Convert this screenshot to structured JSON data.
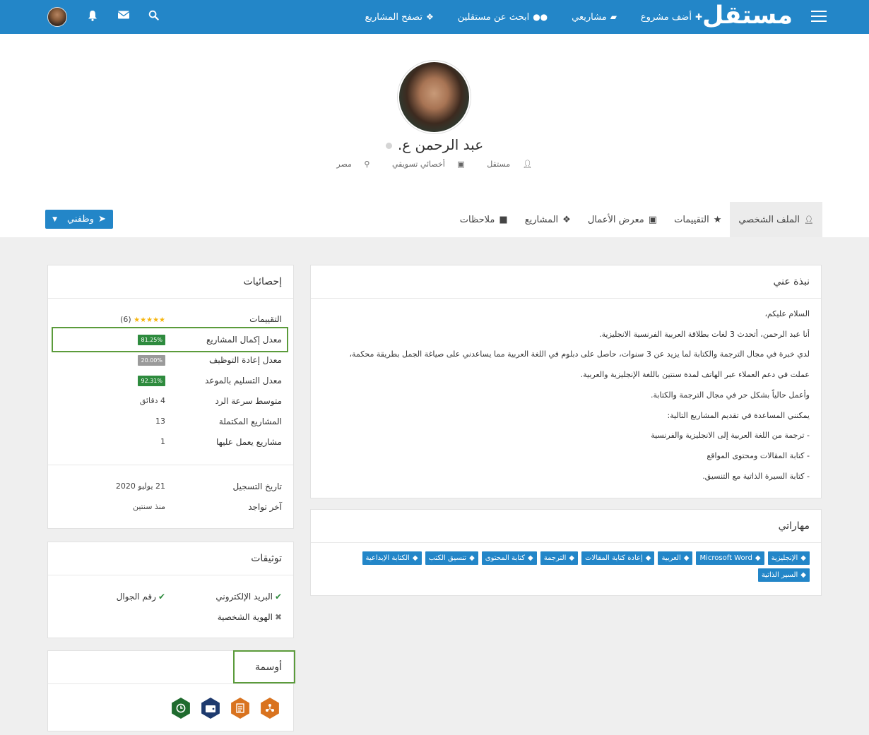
{
  "nav": {
    "logo": "مستقل",
    "links": [
      {
        "label": "أضف مشروع",
        "icon": "plus-icon"
      },
      {
        "label": "مشاريعي",
        "icon": "folder-icon"
      },
      {
        "label": "ابحث عن مستقلين",
        "icon": "users-icon"
      },
      {
        "label": "تصفح المشاريع",
        "icon": "cubes-icon"
      }
    ]
  },
  "profile": {
    "name": "عبد الرحمن ع.",
    "role_site": "مستقل",
    "title": "أخصائي تسويقي",
    "country": "مصر"
  },
  "tabs": [
    {
      "label": "الملف الشخصي",
      "icon": "user-icon"
    },
    {
      "label": "التقييمات",
      "icon": "star-icon"
    },
    {
      "label": "معرض الأعمال",
      "icon": "briefcase-icon"
    },
    {
      "label": "المشاريع",
      "icon": "cubes-icon"
    },
    {
      "label": "ملاحظات",
      "icon": "note-icon"
    }
  ],
  "hire_button": "وظفني",
  "about": {
    "title": "نبذة عني",
    "lines": [
      "السلام عليكم،",
      "أنا عبد الرحمن، أتحدث 3 لغات بطلاقة العربية الفرنسية الانجليزية.",
      "لدي خبرة في مجال الترجمة والكتابة لما يزيد عن 3 سنوات، حاصل على دبلوم في اللغة العربية مما يساعدني على صياغة الجمل بطريقة محكمة،",
      "عملت في دعم العملاء عبر الهاتف لمدة سنتين باللغة الإنجليزية والعربية.",
      "وأعمل حالياً بشكل حر في مجال الترجمة والكتابة.",
      "يمكنني المساعدة في تقديم المشاريع التالية:",
      "- ترجمة من اللغة العربية إلى الانجليزية والفرنسية",
      "- كتابة المقالات ومحتوى المواقع",
      "- كتابة السيرة الذاتية مع التنسيق."
    ]
  },
  "skills": {
    "title": "مهاراتي",
    "items": [
      "الإنجليزية",
      "Microsoft Word",
      "العربية",
      "إعادة كتابة المقالات",
      "الترجمة",
      "كتابة المحتوى",
      "تنسيق الكتب",
      "الكتابة الإبداعية",
      "السير الذاتية"
    ]
  },
  "stats": {
    "title": "إحصائيات",
    "ratings_label": "التقييمات",
    "ratings_count": "(6)",
    "rows": [
      {
        "label": "معدل إكمال المشاريع",
        "value": "81.25%"
      },
      {
        "label": "معدل إعادة التوظيف",
        "value": "20.00%"
      },
      {
        "label": "معدل التسليم بالموعد",
        "value": "92.31%"
      },
      {
        "label": "متوسط سرعة الرد",
        "value": "4 دقائق"
      },
      {
        "label": "المشاريع المكتملة",
        "value": "13"
      },
      {
        "label": "مشاريع يعمل عليها",
        "value": "1"
      }
    ],
    "reg_label": "تاريخ التسجيل",
    "reg_value": "21 يوليو 2020",
    "seen_label": "آخر تواجد",
    "seen_value": "منذ سنتين"
  },
  "verifications": {
    "title": "توثيقات",
    "email": "البريد الإلكتروني",
    "phone": "رقم الجوال",
    "identity": "الهوية الشخصية"
  },
  "badges": {
    "title": "أوسمة",
    "items": [
      {
        "icon": "team-icon",
        "color": "#d9731f"
      },
      {
        "icon": "document-icon",
        "color": "#d9731f"
      },
      {
        "icon": "wallet-icon",
        "color": "#1e3a6e"
      },
      {
        "icon": "clock-icon",
        "color": "#1f6b2e"
      }
    ]
  }
}
